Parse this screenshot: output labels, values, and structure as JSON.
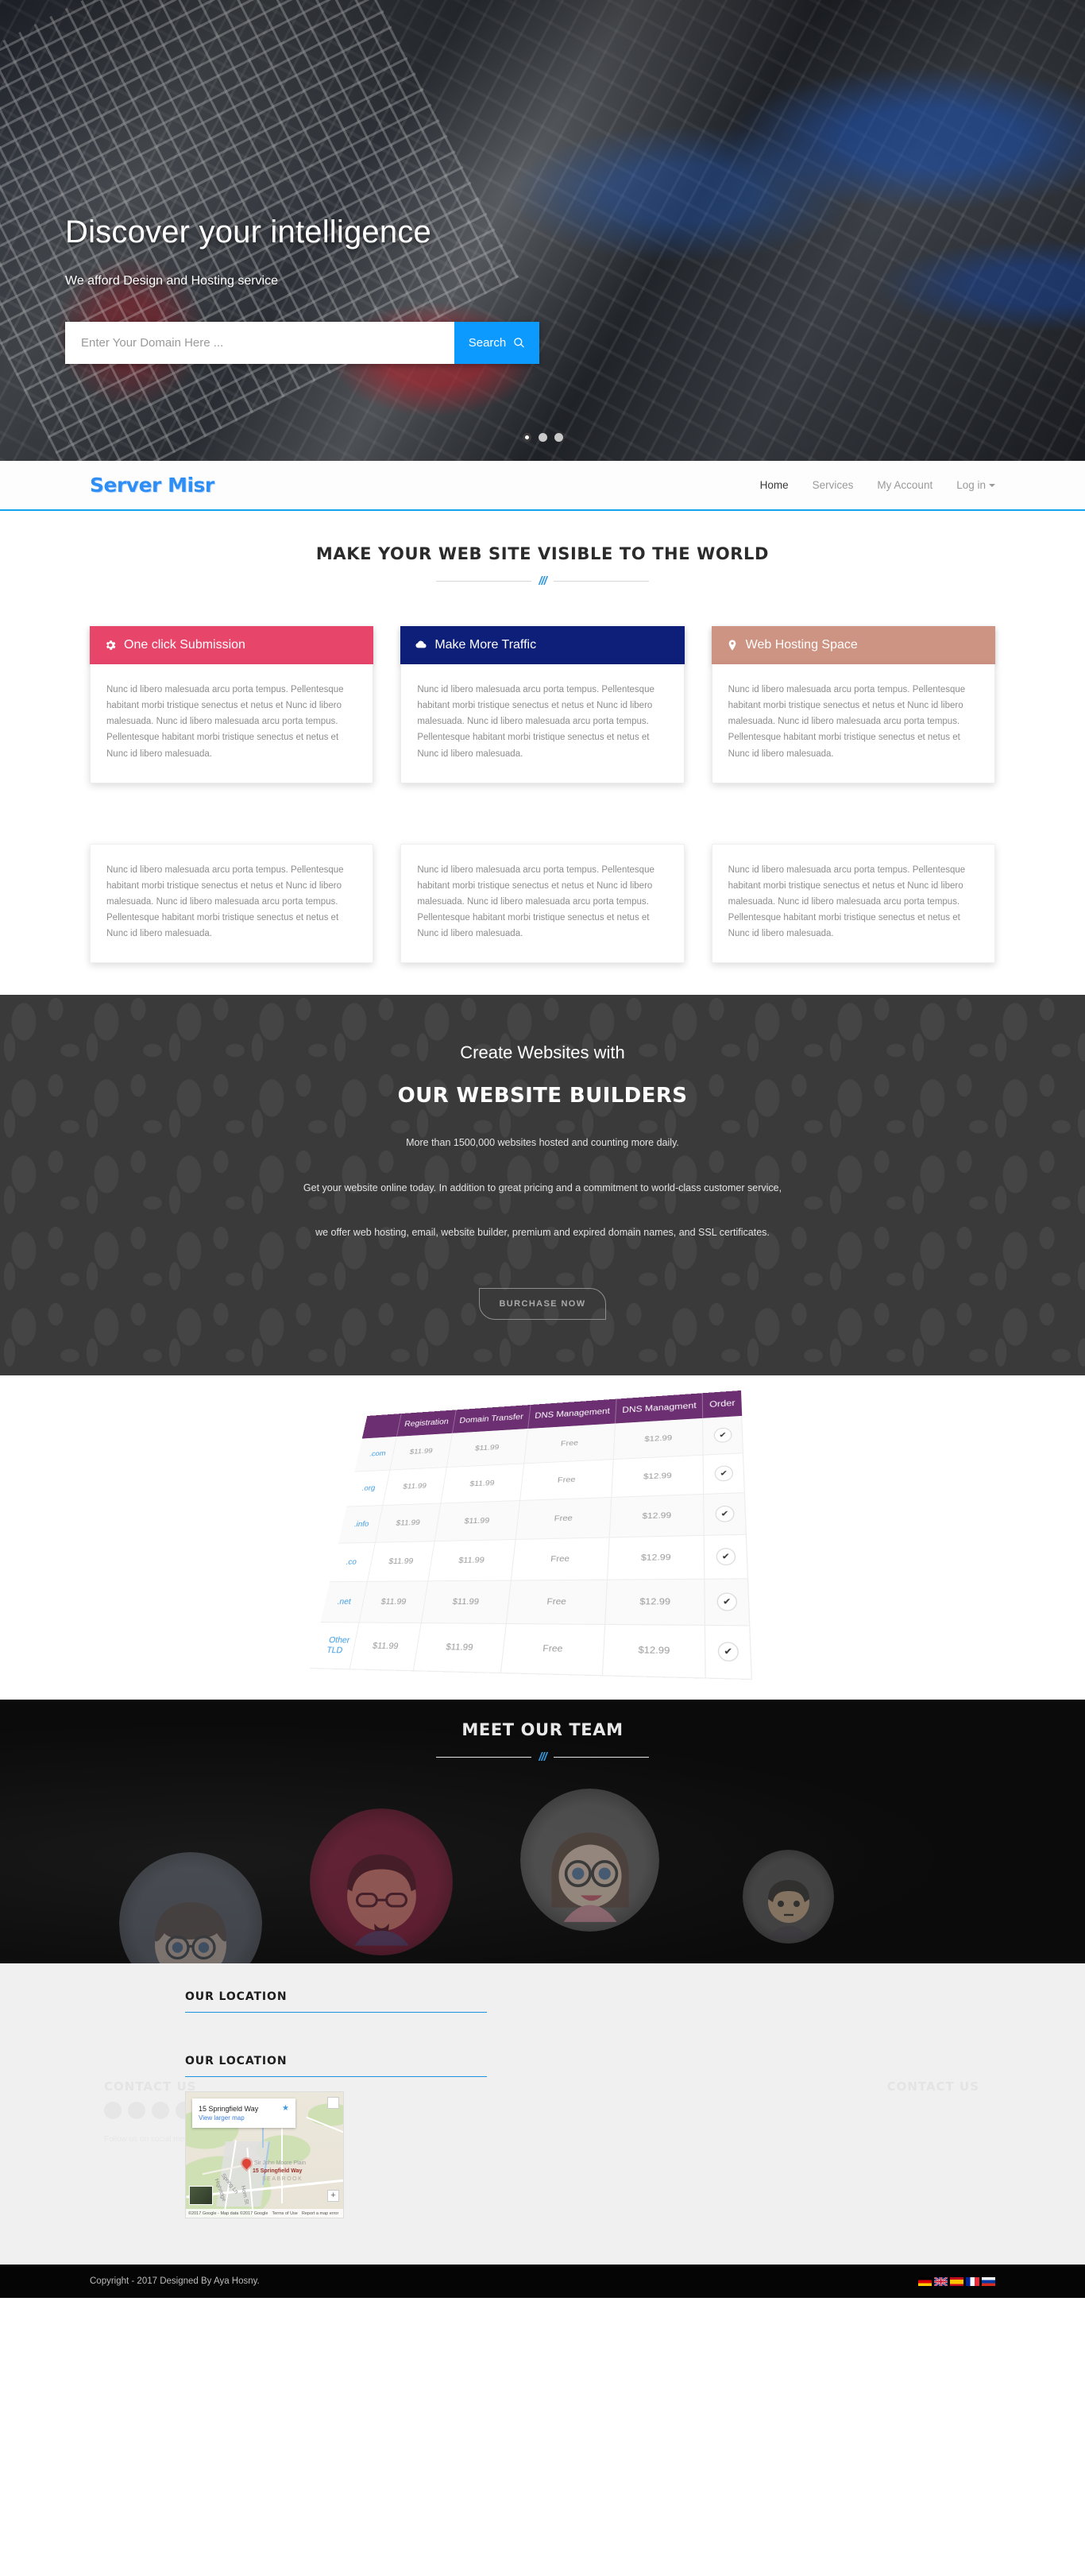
{
  "hero": {
    "title": "Discover your intelligence",
    "subtitle": "We afford Design and Hosting service",
    "search_placeholder": "Enter Your Domain Here ...",
    "search_value": "",
    "search_button": "Search",
    "slides": [
      "slide-1",
      "slide-2",
      "slide-3"
    ],
    "active_slide": 0
  },
  "navbar": {
    "logo": "Server Misr",
    "links": [
      {
        "label": "Home",
        "active": true
      },
      {
        "label": "Services",
        "active": false
      },
      {
        "label": "My Account",
        "active": false
      },
      {
        "label": "Log in",
        "active": false,
        "caret": true
      }
    ]
  },
  "features": {
    "title": "MAKE YOUR WEB SITE VISIBLE TO THE WORLD",
    "body_text": "Nunc id libero malesuada arcu porta tempus. Pellentesque habitant morbi tristique senectus et netus et Nunc id libero malesuada. Nunc id libero malesuada arcu porta tempus. Pellentesque habitant morbi tristique senectus et netus et Nunc id libero malesuada.",
    "cards": [
      {
        "title": "One click Submission",
        "icon": "gear-icon",
        "color": "#e8456b"
      },
      {
        "title": "Make More Traffic",
        "icon": "cloud-icon",
        "color": "#0d1f78"
      },
      {
        "title": "Web Hosting Space",
        "icon": "map-pin-icon",
        "color": "#cd9383"
      }
    ]
  },
  "builders": {
    "pre_title": "Create Websites with",
    "title": "OUR WEBSITE BUILDERS",
    "line1": "More than 1500,000 websites hosted and counting more daily.",
    "line2": "Get your website online today. In addition to great pricing and a commitment to world-class customer service,",
    "line3": "we offer web hosting, email, website builder, premium and expired domain names, and SSL certificates.",
    "button": "BURCHASE NOW"
  },
  "pricing": {
    "headers": [
      "",
      "Registration",
      "Domain Transfer",
      "DNS Management",
      "DNS Managment",
      "Order"
    ],
    "rows": [
      {
        "tld": ".com",
        "registration": "$11.99",
        "transfer": "$11.99",
        "dns1": "Free",
        "dns2": "$12.99",
        "order": "✔"
      },
      {
        "tld": ".org",
        "registration": "$11.99",
        "transfer": "$11.99",
        "dns1": "Free",
        "dns2": "$12.99",
        "order": "✔"
      },
      {
        "tld": ".info",
        "registration": "$11.99",
        "transfer": "$11.99",
        "dns1": "Free",
        "dns2": "$12.99",
        "order": "✔"
      },
      {
        "tld": ".co",
        "registration": "$11.99",
        "transfer": "$11.99",
        "dns1": "Free",
        "dns2": "$12.99",
        "order": "✔"
      },
      {
        "tld": ".net",
        "registration": "$11.99",
        "transfer": "$11.99",
        "dns1": "Free",
        "dns2": "$12.99",
        "order": "✔"
      },
      {
        "tld": "Other TLD",
        "registration": "$11.99",
        "transfer": "$11.99",
        "dns1": "Free",
        "dns2": "$12.99",
        "order": "✔"
      }
    ],
    "header_color": "#6c2f72"
  },
  "team": {
    "title": "MEET OUR TEAM",
    "members": [
      {
        "name": "team-member-1",
        "ring_color": "#b6c4d8"
      },
      {
        "name": "team-member-2",
        "ring_color": "#c4315c"
      },
      {
        "name": "team-member-3",
        "ring_color": "#cfcfcf"
      },
      {
        "name": "team-member-4",
        "ring_color": "#d8d8d8"
      }
    ]
  },
  "location": {
    "heading_1": "OUR LOCATION",
    "heading_2": "OUR LOCATION",
    "ghost_left": "CONTACT US",
    "ghost_right": "CONTACT US",
    "ghost_sub": "Follow us on social media",
    "map": {
      "card_title": "15 Springfield Way",
      "card_link": "View larger map",
      "label_plain": "Sir John Moore Plain",
      "label_address": "15 Springfield Way",
      "label_area": "SEABROOK",
      "street_1": "Spring Ln",
      "street_2": "Highridge",
      "street_3": "Horn St",
      "attribution": "©2017 Google - Map data ©2017 Google",
      "terms": "Terms of Use",
      "report": "Report a map error",
      "zoom_label": "+"
    }
  },
  "footer": {
    "copyright": "Copyright - 2017 Designed By Aya Hosny.",
    "flags": [
      "germany-flag",
      "united-kingdom-flag",
      "spain-flag",
      "france-flag",
      "russia-flag"
    ]
  }
}
